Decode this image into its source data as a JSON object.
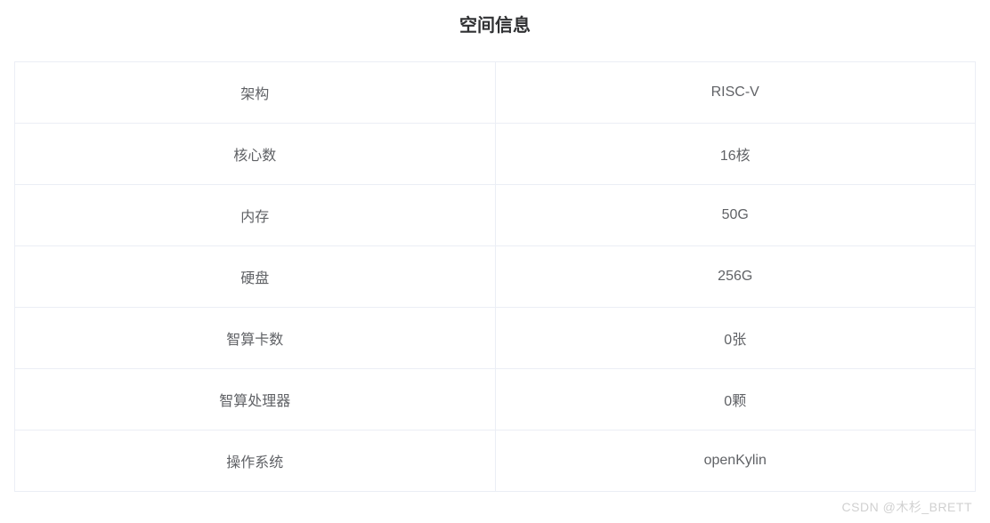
{
  "title": "空间信息",
  "rows": [
    {
      "label": "架构",
      "value": "RISC-V"
    },
    {
      "label": "核心数",
      "value": "16核"
    },
    {
      "label": "内存",
      "value": "50G"
    },
    {
      "label": "硬盘",
      "value": "256G"
    },
    {
      "label": "智算卡数",
      "value": "0张"
    },
    {
      "label": "智算处理器",
      "value": "0颗"
    },
    {
      "label": "操作系统",
      "value": "openKylin"
    }
  ],
  "watermark": "CSDN @木杉_BRETT"
}
